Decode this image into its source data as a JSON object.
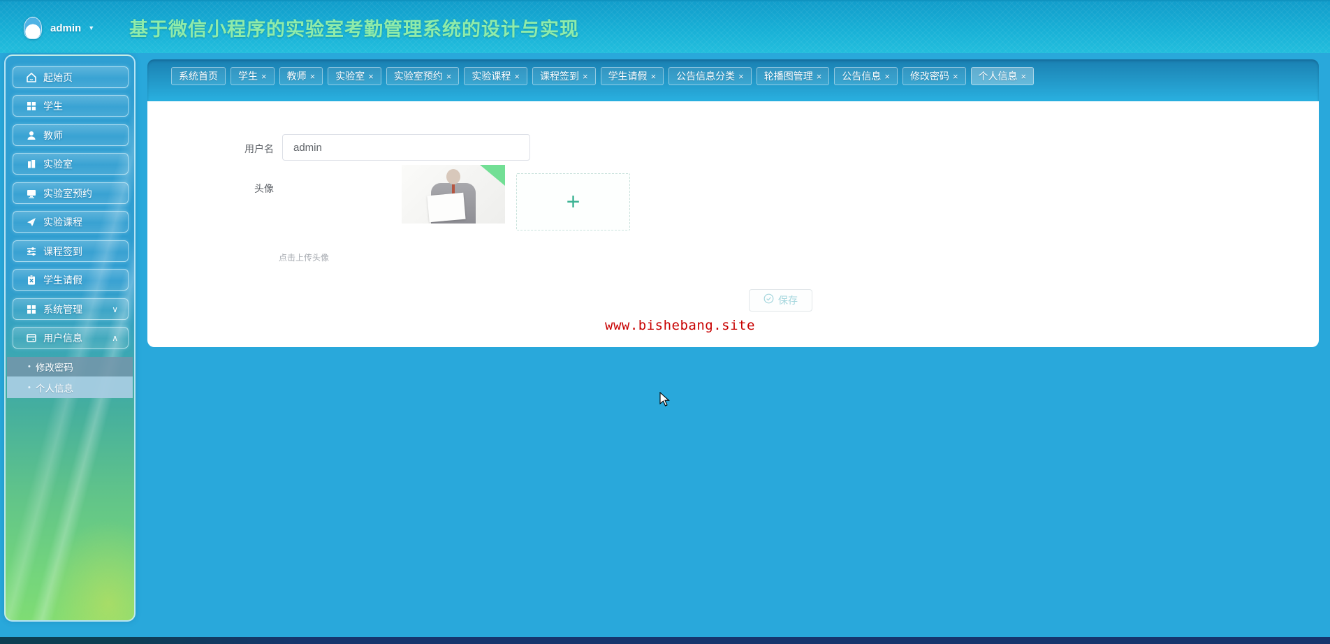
{
  "header": {
    "user": "admin",
    "caret": "▼",
    "title": "基于微信小程序的实验室考勤管理系统的设计与实现"
  },
  "sidebar": {
    "items": [
      {
        "label": "起始页",
        "icon": "home-icon"
      },
      {
        "label": "学生",
        "icon": "grid-icon"
      },
      {
        "label": "教师",
        "icon": "teacher-icon"
      },
      {
        "label": "实验室",
        "icon": "book-icon"
      },
      {
        "label": "实验室预约",
        "icon": "monitor-icon"
      },
      {
        "label": "实验课程",
        "icon": "send-icon"
      },
      {
        "label": "课程签到",
        "icon": "sliders-icon"
      },
      {
        "label": "学生请假",
        "icon": "clipboard-icon"
      },
      {
        "label": "系统管理",
        "icon": "apps-icon",
        "chevron": "∨"
      },
      {
        "label": "用户信息",
        "icon": "card-icon",
        "chevron": "∧"
      }
    ],
    "submenu": [
      {
        "bullet": "•",
        "label": "修改密码",
        "active": false
      },
      {
        "bullet": "•",
        "label": "个人信息",
        "active": true
      }
    ]
  },
  "tabs": [
    {
      "label": "系统首页"
    },
    {
      "label": "学生",
      "close": "×"
    },
    {
      "label": "教师",
      "close": "×"
    },
    {
      "label": "实验室",
      "close": "×"
    },
    {
      "label": "实验室预约",
      "close": "×"
    },
    {
      "label": "实验课程",
      "close": "×"
    },
    {
      "label": "课程签到",
      "close": "×"
    },
    {
      "label": "学生请假",
      "close": "×"
    },
    {
      "label": "公告信息分类",
      "close": "×"
    },
    {
      "label": "轮播图管理",
      "close": "×"
    },
    {
      "label": "公告信息",
      "close": "×"
    },
    {
      "label": "修改密码",
      "close": "×"
    },
    {
      "label": "个人信息",
      "close": "×",
      "active": true
    }
  ],
  "content": {
    "username_label": "用户名",
    "username_value": "admin",
    "avatar_label": "头像",
    "upload_plus": "+",
    "upload_hint": "点击上传头像",
    "save_label": "保存"
  },
  "watermark": "www.bishebang.site",
  "colors": {
    "page_blue": "#29a8db",
    "title_green": "#8febaa",
    "watermark_red": "#c80000",
    "bottom_navy": "#16356d"
  }
}
